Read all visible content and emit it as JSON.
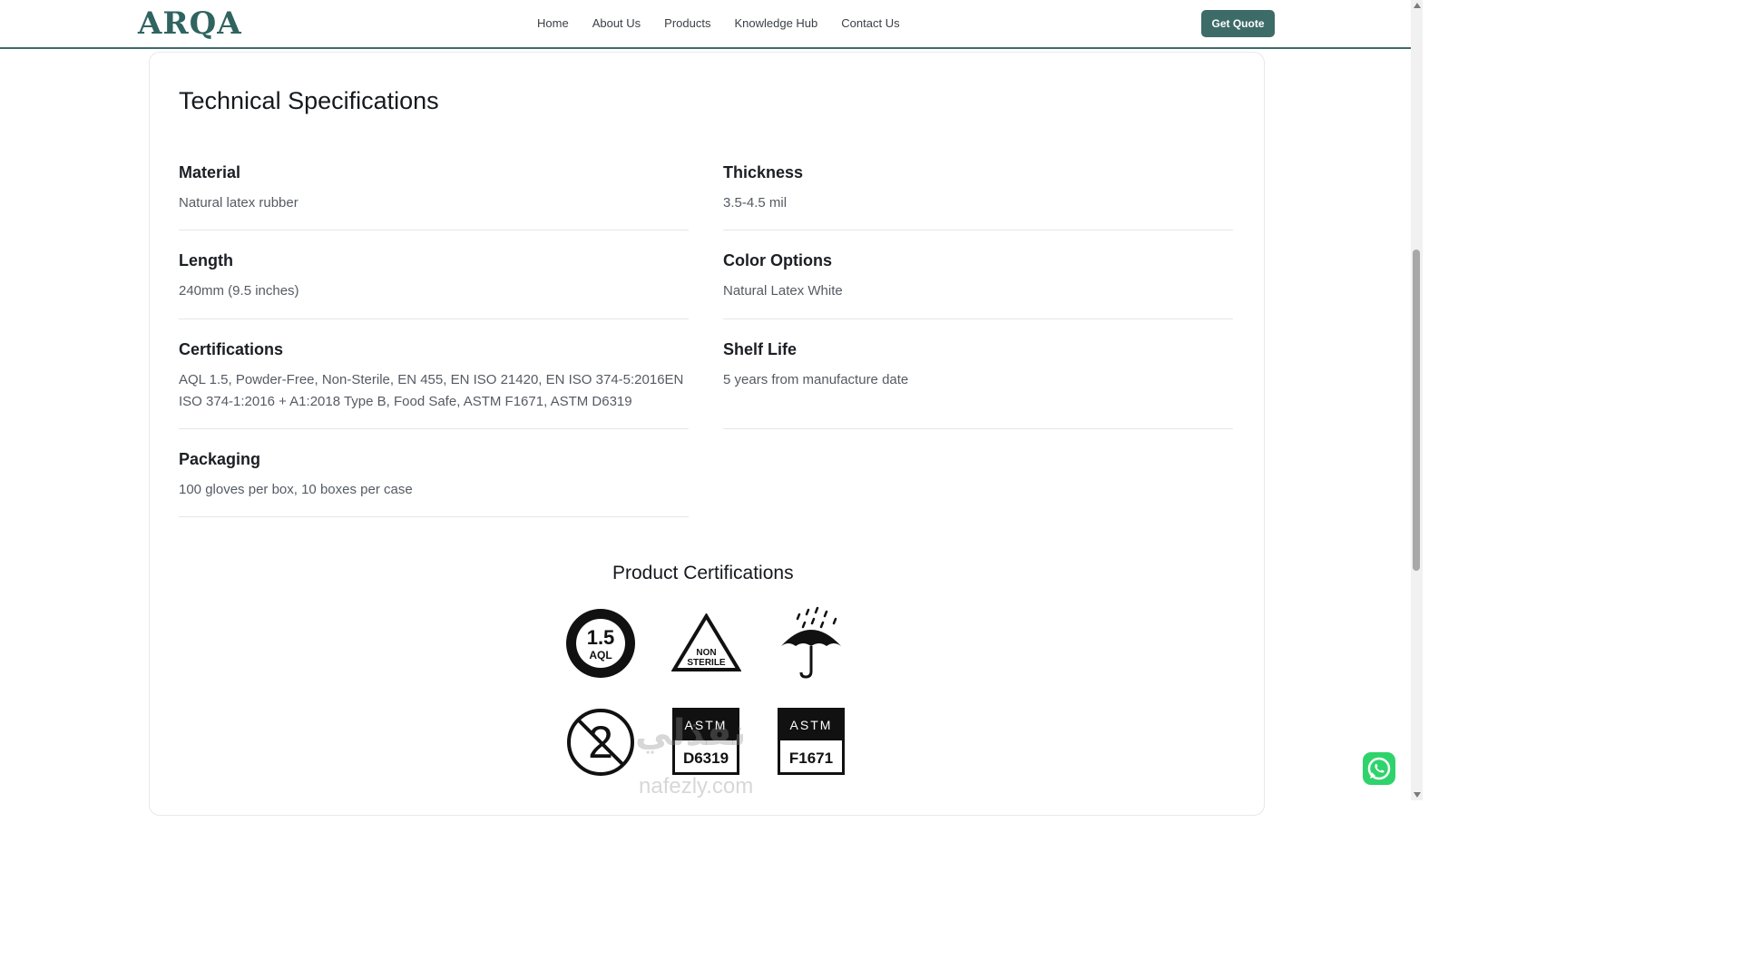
{
  "header": {
    "logo": "ARQA",
    "nav": [
      "Home",
      "About Us",
      "Products",
      "Knowledge Hub",
      "Contact Us"
    ],
    "cta": "Get Quote"
  },
  "specs": {
    "title": "Technical Specifications",
    "items": [
      {
        "label": "Material",
        "value": "Natural latex rubber"
      },
      {
        "label": "Thickness",
        "value": "3.5-4.5 mil"
      },
      {
        "label": "Length",
        "value": "240mm (9.5 inches)"
      },
      {
        "label": "Color Options",
        "value": "Natural Latex White"
      },
      {
        "label": "Certifications",
        "value": "AQL 1.5, Powder-Free, Non-Sterile, EN 455, EN ISO 21420, EN ISO 374-5:2016EN ISO 374-1:2016 + A1:2018 Type B, Food Safe, ASTM F1671, ASTM D6319"
      },
      {
        "label": "Shelf Life",
        "value": "5 years from manufacture date"
      },
      {
        "label": "Packaging",
        "value": "100 gloves per box, 10 boxes per case"
      }
    ]
  },
  "certifications": {
    "title": "Product Certifications",
    "badges": {
      "aql": {
        "num": "1.5",
        "text": "AQL"
      },
      "non_sterile": {
        "line1": "NON",
        "line2": "STERILE"
      },
      "astm1": {
        "top": "ASTM",
        "code": "D6319"
      },
      "astm2": {
        "top": "ASTM",
        "code": "F1671"
      }
    }
  },
  "watermark": {
    "text": "نفذلي",
    "sub": "nafezly.com"
  },
  "colors": {
    "brand": "#3d6b68",
    "whatsapp": "#2fd36b"
  }
}
